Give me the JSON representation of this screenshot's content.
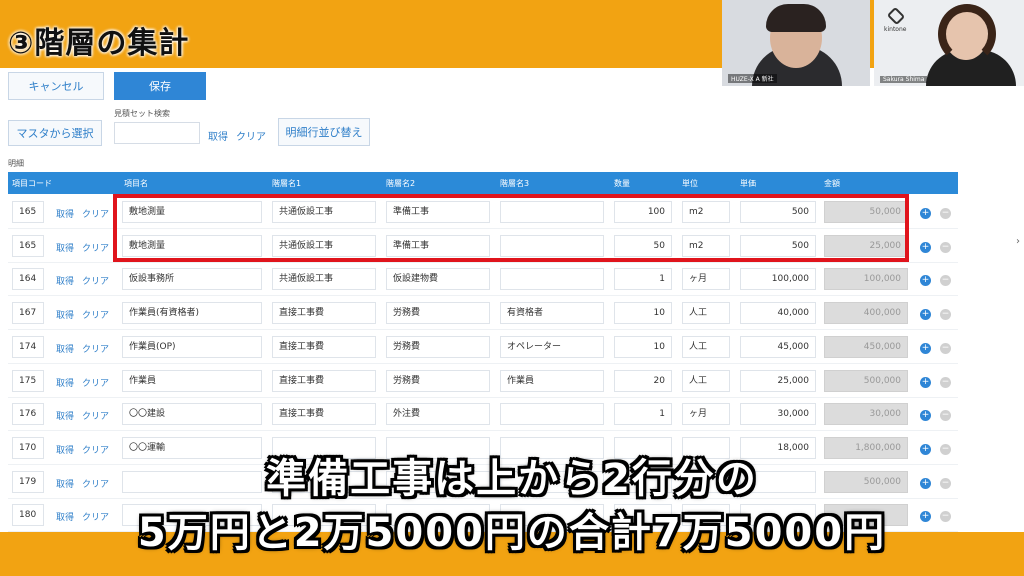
{
  "heading": "③階層の集計",
  "video": {
    "left_name": "HUZE-X A 新社",
    "right_logo": "kintone",
    "right_name": "Sakura Shima"
  },
  "toolbar": {
    "cancel_label": "キャンセル",
    "save_label": "保存",
    "master_select_label": "マスタから選択",
    "estimate_set_search_label": "見積セット検索",
    "get_label": "取得",
    "clear_label": "クリア",
    "reorder_label": "明細行並び替え"
  },
  "section_label": "明細",
  "table": {
    "headers": [
      "項目コード",
      "項目名",
      "階層名1",
      "階層名2",
      "階層名3",
      "数量",
      "単位",
      "単価",
      "金額"
    ],
    "row_get": "取得",
    "row_clear": "クリア",
    "rows": [
      {
        "code": "165",
        "name": "敷地測量",
        "l1": "共通仮設工事",
        "l2": "準備工事",
        "l3": "",
        "qty": "100",
        "unit": "m2",
        "price": "500",
        "amount": "50,000"
      },
      {
        "code": "165",
        "name": "敷地測量",
        "l1": "共通仮設工事",
        "l2": "準備工事",
        "l3": "",
        "qty": "50",
        "unit": "m2",
        "price": "500",
        "amount": "25,000"
      },
      {
        "code": "164",
        "name": "仮設事務所",
        "l1": "共通仮設工事",
        "l2": "仮設建物費",
        "l3": "",
        "qty": "1",
        "unit": "ヶ月",
        "price": "100,000",
        "amount": "100,000"
      },
      {
        "code": "167",
        "name": "作業員(有資格者)",
        "l1": "直接工事費",
        "l2": "労務費",
        "l3": "有資格者",
        "qty": "10",
        "unit": "人工",
        "price": "40,000",
        "amount": "400,000"
      },
      {
        "code": "174",
        "name": "作業員(OP)",
        "l1": "直接工事費",
        "l2": "労務費",
        "l3": "オペレーター",
        "qty": "10",
        "unit": "人工",
        "price": "45,000",
        "amount": "450,000"
      },
      {
        "code": "175",
        "name": "作業員",
        "l1": "直接工事費",
        "l2": "労務費",
        "l3": "作業員",
        "qty": "20",
        "unit": "人工",
        "price": "25,000",
        "amount": "500,000"
      },
      {
        "code": "176",
        "name": "〇〇建設",
        "l1": "直接工事費",
        "l2": "外注費",
        "l3": "",
        "qty": "1",
        "unit": "ヶ月",
        "price": "30,000",
        "amount": "30,000"
      },
      {
        "code": "170",
        "name": "〇〇運輸",
        "l1": "",
        "l2": "",
        "l3": "",
        "qty": "",
        "unit": "",
        "price": "18,000",
        "amount": "1,800,000"
      },
      {
        "code": "179",
        "name": "",
        "l1": "",
        "l2": "",
        "l3": "",
        "qty": "",
        "unit": "",
        "price": "",
        "amount": "500,000"
      },
      {
        "code": "180",
        "name": "",
        "l1": "",
        "l2": "",
        "l3": "",
        "qty": "",
        "unit": "",
        "price": "",
        "amount": ""
      }
    ]
  },
  "caption": {
    "line1": "準備工事は上から2行分の",
    "line2": "5万円と2万5000円の合計7万5000円"
  },
  "colors": {
    "accent": "#2f86d6",
    "highlight": "#e0141c",
    "band": "#f2a312"
  }
}
